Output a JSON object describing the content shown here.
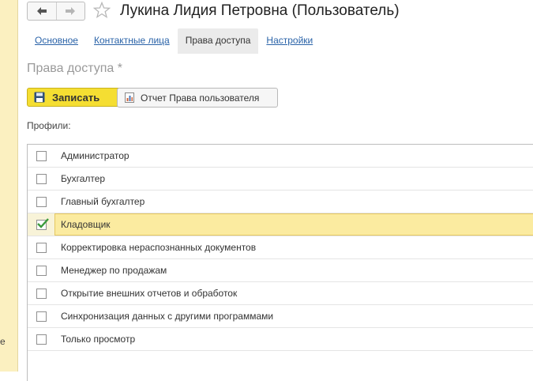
{
  "side": {
    "partial_text": "е"
  },
  "window": {
    "title": "Лукина Лидия Петровна (Пользователь)",
    "nav_back_icon": "arrow-left-icon",
    "nav_forward_icon": "arrow-right-icon",
    "favorite_icon": "star-icon"
  },
  "tabs": [
    {
      "label": "Основное",
      "active": false
    },
    {
      "label": "Контактные лица",
      "active": false
    },
    {
      "label": "Права доступа",
      "active": true
    },
    {
      "label": "Настройки",
      "active": false
    }
  ],
  "section_title": "Права доступа *",
  "toolbar": {
    "save_label": "Записать",
    "save_icon": "floppy-disk-icon",
    "report_label": "Отчет Права пользователя",
    "report_icon": "report-chart-icon"
  },
  "profiles_label": "Профили:",
  "profiles": [
    {
      "label": "Администратор",
      "checked": false
    },
    {
      "label": "Бухгалтер",
      "checked": false
    },
    {
      "label": "Главный бухгалтер",
      "checked": false
    },
    {
      "label": "Кладовщик",
      "checked": true
    },
    {
      "label": "Корректировка нераспознанных документов",
      "checked": false
    },
    {
      "label": "Менеджер по продажам",
      "checked": false
    },
    {
      "label": "Открытие внешних отчетов и обработок",
      "checked": false
    },
    {
      "label": "Синхронизация данных с другими программами",
      "checked": false
    },
    {
      "label": "Только просмотр",
      "checked": false
    }
  ],
  "colors": {
    "accent_yellow": "#f5de32",
    "link_blue": "#2a63a8",
    "selection": "#fbeba0",
    "check_green": "#3a9a3a"
  }
}
